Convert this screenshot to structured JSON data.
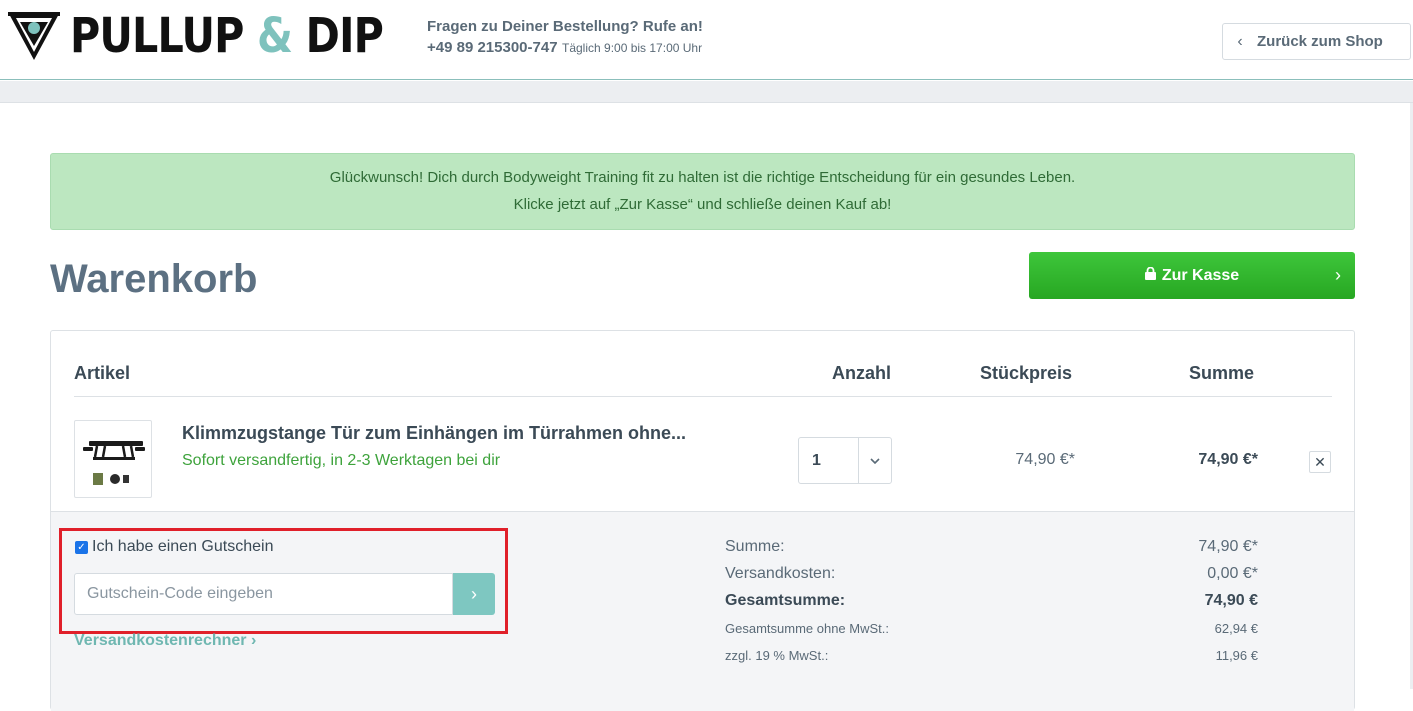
{
  "header": {
    "logo": {
      "text_a": "PULLUP ",
      "text_amp": "&",
      "text_b": " DIP"
    },
    "hotline": {
      "question": "Fragen zu Deiner Bestellung? Rufe an!",
      "phone": "+49 89 215300-747",
      "hours": "Täglich 9:00 bis 17:00 Uhr"
    },
    "back_label": "Zurück zum Shop"
  },
  "alert": {
    "line1": "Glückwunsch! Dich durch Bodyweight Training fit zu halten ist die richtige Entscheidung für ein gesundes Leben.",
    "line2": "Klicke jetzt auf „Zur Kasse“ und schließe deinen Kauf ab!"
  },
  "page_title": "Warenkorb",
  "checkout_label": "Zur Kasse",
  "cart": {
    "headers": {
      "article": "Artikel",
      "qty": "Anzahl",
      "unit_price": "Stückpreis",
      "total": "Summe"
    },
    "item": {
      "name": "Klimmzugstange Tür zum Einhängen im Türrahmen ohne...",
      "stock": "Sofort versandfertig, in 2-3 Werktagen bei dir",
      "qty": "1",
      "unit_price": "74,90 €*",
      "total": "74,90 €*",
      "remove": "✕"
    }
  },
  "voucher": {
    "checkbox_label": "Ich habe einen Gutschein",
    "checked": true,
    "placeholder": "Gutschein-Code eingeben",
    "submit": "›"
  },
  "shipping_calc_label": "Versandkostenrechner ›",
  "summary": {
    "sum_label": "Summe:",
    "sum_value": "74,90 €*",
    "shipping_label": "Versandkosten:",
    "shipping_value": "0,00 €*",
    "grand_label": "Gesamtsumme:",
    "grand_value": "74,90 €",
    "net_label": "Gesamtsumme ohne MwSt.:",
    "net_value": "62,94 €",
    "vat_label": "zzgl. 19 % MwSt.:",
    "vat_value": "11,96 €"
  },
  "colors": {
    "accent_teal": "#7ec2bd",
    "checkout_green": "#2fb52b",
    "alert_bg": "#bce7c0",
    "stock_green": "#3ea33c",
    "highlight_red": "#e0202a"
  }
}
